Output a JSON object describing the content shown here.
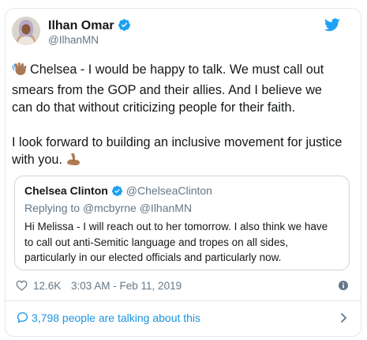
{
  "author": {
    "name": "Ilhan Omar",
    "handle": "@IlhanMN",
    "verified_icon": "verified-badge-icon",
    "avatar_icon": "profile-photo"
  },
  "brand_icon": "twitter-bird-icon",
  "tweet": {
    "paragraph1": "Chelsea - I would be happy to talk. We must call out smears from the GOP and their allies. And I believe we can do that without criticizing people for their faith.",
    "paragraph1_emoji": "waving-hand-emoji",
    "paragraph2": "I look forward to building an inclusive movement for justice with you.",
    "paragraph2_emoji": "flexed-biceps-emoji"
  },
  "quoted_tweet": {
    "name": "Chelsea Clinton",
    "handle": "@ChelseaClinton",
    "replying_prefix": "Replying to",
    "replying_to": "@mcbyrne @IlhanMN",
    "text": "Hi Melissa - I will reach out to her tomorrow. I also think we have to call out anti-Semitic language and tropes on all sides, particularly in our elected officials and particularly now."
  },
  "meta": {
    "likes": "12.6K",
    "timestamp": "3:03 AM - Feb 11, 2019"
  },
  "footer": {
    "talking_text": "3,798 people are talking about this"
  },
  "colors": {
    "link": "#1b95e0",
    "muted": "#657786",
    "text": "#14171a",
    "border": "#e1e8ed"
  }
}
